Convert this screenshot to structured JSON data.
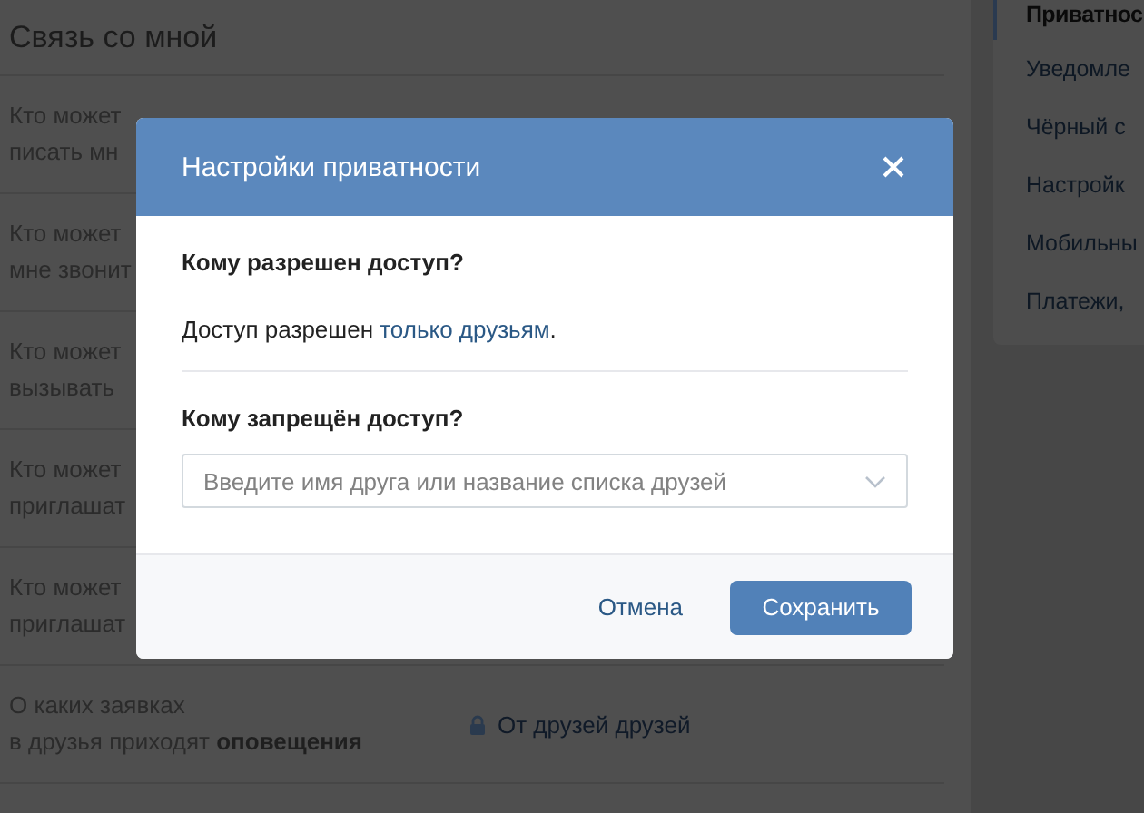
{
  "section": {
    "title": "Связь со мной",
    "rows": [
      {
        "lines": [
          "Кто может",
          "писать мн"
        ]
      },
      {
        "lines": [
          "Кто может",
          "мне звонит"
        ]
      },
      {
        "lines": [
          "Кто может",
          "вызывать"
        ]
      },
      {
        "lines": [
          "Кто может",
          "приглашат"
        ]
      },
      {
        "lines": [
          "Кто может",
          "приглашат"
        ]
      },
      {
        "lines": [
          "О каких заявках",
          "в друзья приходят **оповещения**"
        ],
        "value": "От друзей друзей"
      }
    ]
  },
  "sidebar": {
    "items": [
      {
        "label": "Приватнос",
        "selected": true
      },
      {
        "label": "Уведомле",
        "selected": false
      },
      {
        "label": "Чёрный с",
        "selected": false
      },
      {
        "label": "Настройк",
        "selected": false
      },
      {
        "label": "Мобильны",
        "selected": false
      },
      {
        "label": "Платежи,",
        "selected": false
      }
    ]
  },
  "dialog": {
    "title": "Настройки приватности",
    "allowed": {
      "heading": "Кому разрешен доступ?",
      "text": "Доступ разрешен ",
      "link": "только друзьям",
      "after": "."
    },
    "denied": {
      "heading": "Кому запрещён доступ?",
      "placeholder": "Введите имя друга или название списка друзей"
    },
    "buttons": [
      {
        "label": "Отмена",
        "kind": "link"
      },
      {
        "label": "Сохранить",
        "kind": "primary"
      }
    ]
  }
}
